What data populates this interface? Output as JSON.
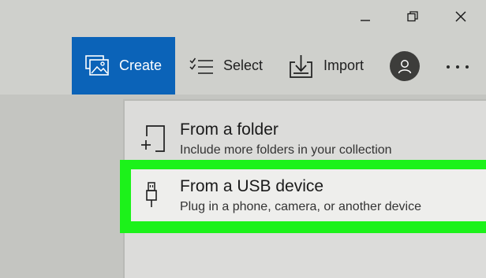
{
  "window": {
    "minimize_icon": "minimize-icon",
    "maximize_icon": "restore-icon",
    "close_icon": "close-icon"
  },
  "toolbar": {
    "create_label": "Create",
    "select_label": "Select",
    "import_label": "Import",
    "accent_color": "#0b63b8"
  },
  "menu": {
    "items": [
      {
        "title": "From a folder",
        "subtitle": "Include more folders in your collection",
        "icon": "add-folder-icon"
      },
      {
        "title": "From a USB device",
        "subtitle": "Plug in a phone, camera, or another device",
        "icon": "usb-icon"
      }
    ],
    "highlight_color": "#1cf21a"
  }
}
